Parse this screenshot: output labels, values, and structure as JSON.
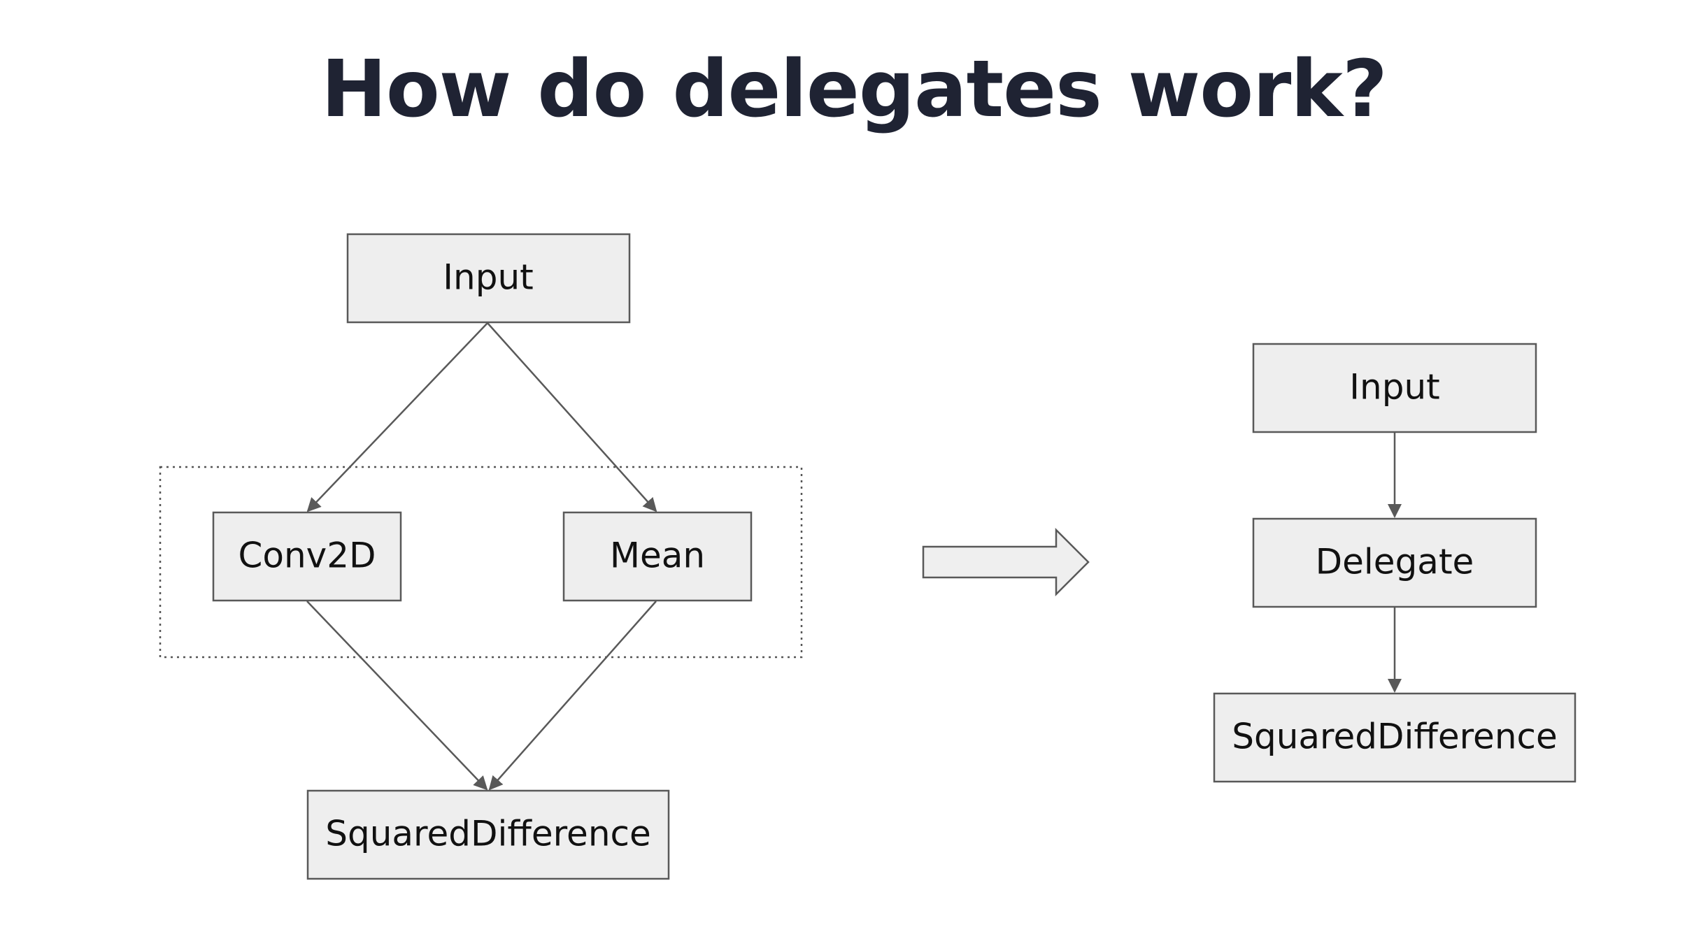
{
  "title": "How do delegates work?",
  "left_graph": {
    "input": "Input",
    "conv2d": "Conv2D",
    "mean": "Mean",
    "squared_difference": "SquaredDifference"
  },
  "right_graph": {
    "input": "Input",
    "delegate": "Delegate",
    "squared_difference": "SquaredDifference"
  },
  "colors": {
    "title": "#1f2333",
    "node_fill": "#eeeeee",
    "stroke": "#595959"
  }
}
